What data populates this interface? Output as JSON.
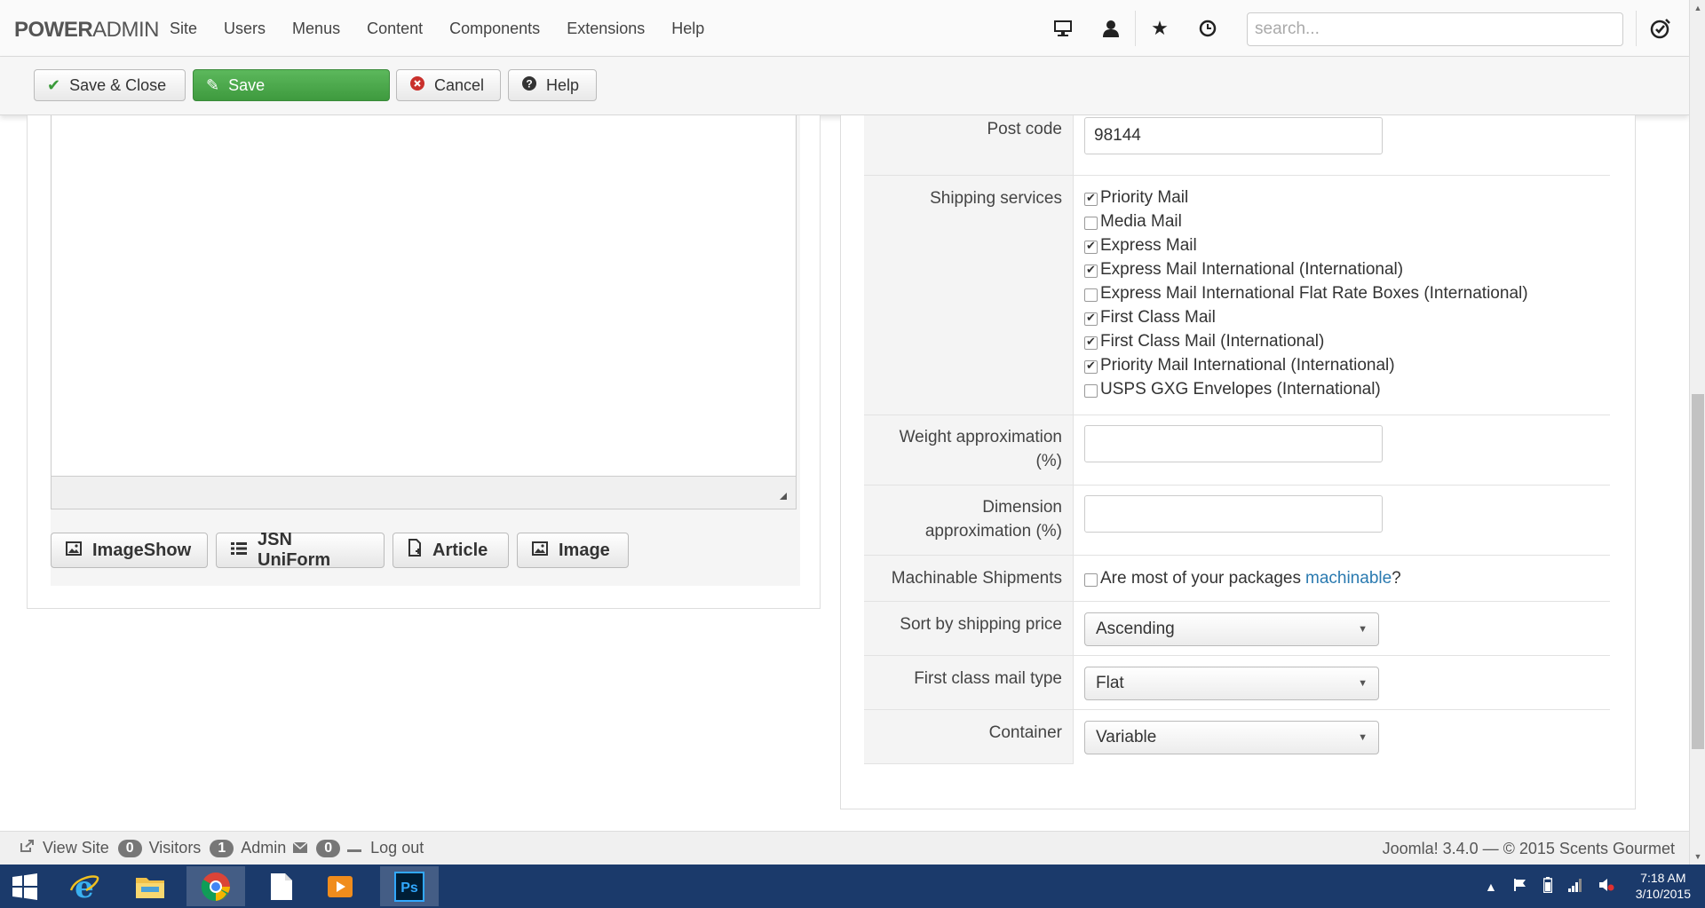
{
  "brand": {
    "bold": "POWER",
    "thin": "ADMIN"
  },
  "menu": [
    "Site",
    "Users",
    "Menus",
    "Content",
    "Components",
    "Extensions",
    "Help"
  ],
  "search": {
    "placeholder": "search..."
  },
  "toolbar": {
    "save_close": "Save & Close",
    "save": "Save",
    "cancel": "Cancel",
    "help": "Help"
  },
  "editor_buttons": {
    "imageshow": "ImageShow",
    "jsonuniform": "JSN UniForm",
    "article": "Article",
    "image": "Image"
  },
  "form": {
    "post_code": {
      "label": "Post code",
      "value": "98144"
    },
    "shipping_services": {
      "label": "Shipping services",
      "options": [
        {
          "label": "Priority Mail",
          "checked": true
        },
        {
          "label": "Media Mail",
          "checked": false
        },
        {
          "label": "Express Mail",
          "checked": true
        },
        {
          "label": "Express Mail International (International)",
          "checked": true
        },
        {
          "label": "Express Mail International Flat Rate Boxes (International)",
          "checked": false
        },
        {
          "label": "First Class Mail",
          "checked": true
        },
        {
          "label": "First Class Mail (International)",
          "checked": true
        },
        {
          "label": "Priority Mail International (International)",
          "checked": true
        },
        {
          "label": "USPS GXG Envelopes (International)",
          "checked": false
        }
      ]
    },
    "weight": {
      "label_1": "Weight approximation",
      "label_2": "(%)",
      "value": ""
    },
    "dimension": {
      "label_1": "Dimension",
      "label_2": "approximation (%)",
      "value": ""
    },
    "machinable": {
      "label": "Machinable Shipments",
      "text_before": "Are most of your packages ",
      "link": "machinable",
      "text_after": "?",
      "checked": false
    },
    "sort": {
      "label": "Sort by shipping price",
      "value": "Ascending"
    },
    "first_class": {
      "label": "First class mail type",
      "value": "Flat"
    },
    "container": {
      "label": "Container",
      "value": "Variable"
    }
  },
  "footer": {
    "view_site": "View Site",
    "visitors_count": "0",
    "visitors": "Visitors",
    "admin_count": "1",
    "admin": "Admin",
    "messages_count": "0",
    "logout": "Log out",
    "version": "Joomla! 3.4.0  —  © 2015 Scents Gourmet"
  },
  "taskbar": {
    "time": "7:18 AM",
    "date": "3/10/2015"
  },
  "colors": {
    "save_green": "#4cae4c",
    "link_blue": "#2a7ab0",
    "taskbar": "#1b3a6b"
  }
}
